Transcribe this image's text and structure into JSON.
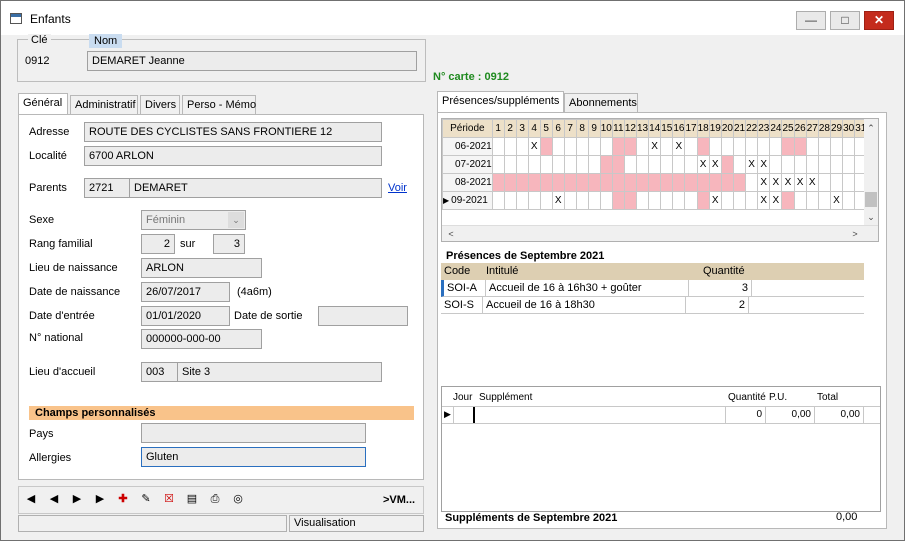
{
  "window": {
    "title": "Enfants",
    "icons": [
      "window-app-icon",
      "minimize-icon",
      "maximize-icon",
      "close-icon"
    ]
  },
  "key": {
    "cle_label": "Clé",
    "nom_label": "Nom",
    "code": "0912",
    "name": "DEMARET Jeanne",
    "card": "N° carte : 0912",
    "card_color": "#1f8a1f"
  },
  "left_tabs": [
    "Général",
    "Administratif",
    "Divers",
    "Perso - Mémo"
  ],
  "general": {
    "adresse_label": "Adresse",
    "adresse": "ROUTE DES CYCLISTES SANS FRONTIERE 12",
    "localite_label": "Localité",
    "localite": "6700 ARLON",
    "parents_label": "Parents",
    "parents_code": "2721",
    "parents_name": "DEMARET",
    "voir": "Voir",
    "sexe_label": "Sexe",
    "sexe": "Féminin",
    "rang_label": "Rang familial",
    "rang": "2",
    "sur_label": "sur",
    "sur": "3",
    "lieu_naissance_label": "Lieu de naissance",
    "lieu_naissance": "ARLON",
    "date_naissance_label": "Date de naissance",
    "date_naissance": "26/07/2017",
    "age": "(4a6m)",
    "date_entree_label": "Date d'entrée",
    "date_entree": "01/01/2020",
    "date_sortie_label": "Date de sortie",
    "date_sortie": "",
    "national_label": "N° national",
    "national": "000000-000-00",
    "accueil_label": "Lieu d'accueil",
    "accueil_code": "003",
    "accueil_name": "Site 3"
  },
  "custom": {
    "header": "Champs personnalisés",
    "header_color": "#f9c38a",
    "pays_label": "Pays",
    "pays": "",
    "allergies_label": "Allergies",
    "allergies": "Gluten"
  },
  "navigation": {
    "icons": [
      "first-record-icon",
      "previous-record-icon",
      "next-record-icon",
      "last-record-icon",
      "add-record-icon",
      "edit-record-icon",
      "delete-record-icon",
      "list-icon",
      "print-icon",
      "search-icon"
    ],
    "vm_label": ">VM..."
  },
  "status": {
    "left": "",
    "mode": "Visualisation"
  },
  "right_tabs": [
    "Présences/suppléments",
    "Abonnements"
  ],
  "presence_grid": {
    "header": "Période",
    "days": [
      "1",
      "2",
      "3",
      "4",
      "5",
      "6",
      "7",
      "8",
      "9",
      "10",
      "11",
      "12",
      "13",
      "14",
      "15",
      "16",
      "17",
      "18",
      "19",
      "20",
      "21",
      "22",
      "23",
      "24",
      "25",
      "26",
      "27",
      "28",
      "29",
      "30",
      "31"
    ],
    "rows": [
      {
        "period": "06-2021",
        "cells": [
          "",
          "",
          "",
          "X",
          "p",
          "",
          "",
          "",
          "",
          "",
          "p",
          "p",
          "",
          "X",
          "",
          "X",
          "",
          "p",
          "",
          "",
          "",
          "",
          "",
          "",
          "p",
          "p",
          "",
          "",
          "",
          "",
          ""
        ],
        "current": false
      },
      {
        "period": "07-2021",
        "cells": [
          "",
          "",
          "",
          "",
          "",
          "",
          "",
          "",
          "",
          "p",
          "p",
          "",
          "",
          "",
          "",
          "",
          "",
          "X",
          "X",
          "p",
          "",
          "X",
          "X",
          "",
          "",
          "",
          "",
          "",
          "",
          "",
          ""
        ],
        "current": false
      },
      {
        "period": "08-2021",
        "cells": [
          "p",
          "p",
          "p",
          "p",
          "p",
          "p",
          "p",
          "p",
          "p",
          "p",
          "p",
          "p",
          "p",
          "p",
          "p",
          "p",
          "p",
          "p",
          "p",
          "p",
          "p",
          "",
          "X",
          "X",
          "X",
          "X",
          "X",
          "",
          "",
          "",
          ""
        ],
        "current": false
      },
      {
        "period": "09-2021",
        "cells": [
          "",
          "",
          "",
          "",
          "",
          "X",
          "",
          "",
          "",
          "",
          "p",
          "p",
          "",
          "",
          "",
          "",
          "",
          "p",
          "X",
          "",
          "",
          "",
          "X",
          "X",
          "p",
          "",
          "",
          "",
          "X",
          "",
          ""
        ],
        "current": true
      }
    ],
    "pink_color": "#f7b6bd"
  },
  "presences": {
    "title": "Présences de Septembre 2021",
    "columns": [
      "Code",
      "Intitulé",
      "Quantité"
    ],
    "rows": [
      {
        "code": "SOI-A",
        "label": "Accueil de 16 à 16h30 + goûter",
        "qty": "3"
      },
      {
        "code": "SOI-S",
        "label": "Accueil de 16 à 18h30",
        "qty": "2"
      }
    ]
  },
  "supplements": {
    "columns": [
      "Jour",
      "Supplément",
      "Quantité",
      "P.U.",
      "Total"
    ],
    "rows": [
      {
        "jour": "",
        "supplement": "",
        "qty": "0",
        "pu": "0,00",
        "total": "0,00"
      }
    ],
    "footer_label": "Suppléments de Septembre 2021",
    "footer_total": "0,00"
  }
}
